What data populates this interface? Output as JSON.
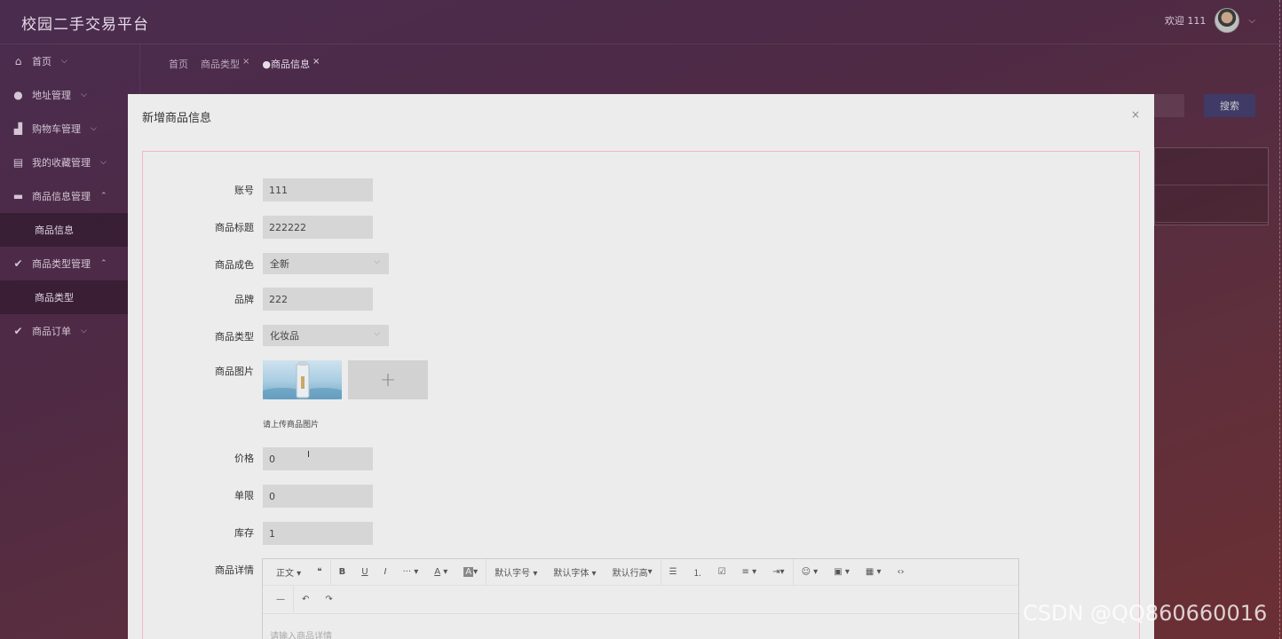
{
  "app": {
    "title": "校园二手交易平台"
  },
  "header": {
    "welcome": "欢迎 111"
  },
  "sidebar": {
    "items": [
      {
        "label": "首页"
      },
      {
        "label": "地址管理"
      },
      {
        "label": "购物车管理"
      },
      {
        "label": "我的收藏管理"
      },
      {
        "label": "商品信息管理"
      },
      {
        "label": "商品信息"
      },
      {
        "label": "商品类型管理"
      },
      {
        "label": "商品类型"
      },
      {
        "label": "商品订单"
      }
    ]
  },
  "tabs": [
    {
      "label": "首页"
    },
    {
      "label": "商品类型"
    },
    {
      "label": "●商品信息"
    }
  ],
  "background": {
    "search_label": "搜索"
  },
  "modal": {
    "title": "新增商品信息",
    "close": "×",
    "fields": {
      "account": {
        "label": "账号",
        "value": "111"
      },
      "title": {
        "label": "商品标题",
        "value": "222222"
      },
      "condition": {
        "label": "商品成色",
        "value": "全新"
      },
      "brand": {
        "label": "品牌",
        "value": "222"
      },
      "category": {
        "label": "商品类型",
        "value": "化妆品"
      },
      "image": {
        "label": "商品图片",
        "hint": "请上传商品图片",
        "add": "+"
      },
      "price": {
        "label": "价格",
        "value": "0"
      },
      "limit": {
        "label": "单限",
        "value": "0"
      },
      "stock": {
        "label": "库存",
        "value": "1"
      },
      "detail": {
        "label": "商品详情",
        "placeholder": "请输入商品详情"
      }
    },
    "editor_toolbar": {
      "paragraph": "正文",
      "quote": "❝",
      "bold": "B",
      "underline": "U",
      "italic": "I",
      "more": "···",
      "font_color": "A",
      "bg_color": "A",
      "font_size": "默认字号",
      "font_family": "默认字体",
      "line_height": "默认行高",
      "bullet_list": "☰",
      "numbered_list": "⒈",
      "todo": "☑",
      "align": "≡",
      "indent": "⇥",
      "emoji": "☺",
      "image": "▣",
      "table": "▦",
      "code": "‹›",
      "divider": "—",
      "undo": "↶",
      "redo": "↷"
    }
  },
  "watermark": "CSDN @QQ860660016"
}
